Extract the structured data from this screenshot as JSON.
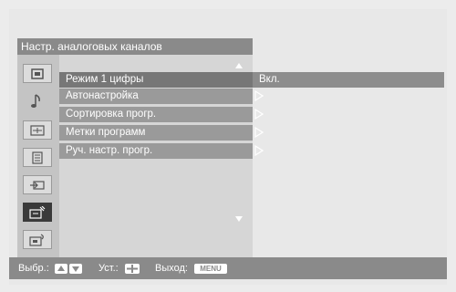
{
  "menu": {
    "title": "Настр. аналоговых каналов",
    "items": [
      {
        "label": "Режим 1 цифры",
        "value": "Вкл."
      },
      {
        "label": "Автонастройка"
      },
      {
        "label": "Сортировка прогр."
      },
      {
        "label": "Метки программ"
      },
      {
        "label": "Руч. настр. прогр."
      }
    ]
  },
  "categories": [
    {
      "icon": "picture-icon"
    },
    {
      "icon": "sound-icon"
    },
    {
      "icon": "screen-icon"
    },
    {
      "icon": "setup-icon"
    },
    {
      "icon": "input-icon"
    },
    {
      "icon": "analog-setup-icon",
      "selected": true
    },
    {
      "icon": "digital-setup-icon"
    }
  ],
  "footer": {
    "select_label": "Выбр.:",
    "set_label": "Уст.:",
    "exit_label": "Выход:",
    "menu_key": "MENU"
  },
  "colors": {
    "title_bar": "#8a8a8a",
    "item_bg": "#9a9a9a",
    "selected_icon": "#3a3a3a"
  }
}
